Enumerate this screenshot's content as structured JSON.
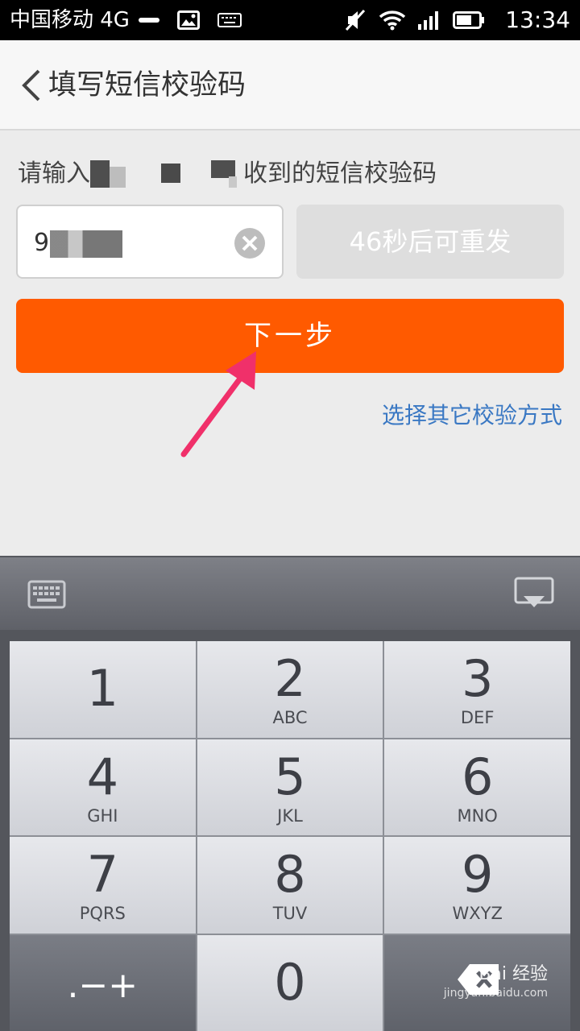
{
  "status_bar": {
    "carrier": "中国移动 4G",
    "time": "13:34"
  },
  "header": {
    "title": "填写短信校验码"
  },
  "content": {
    "prompt_prefix": "请输入",
    "prompt_suffix": "收到的短信校验码",
    "code_value": "9",
    "resend_label": "46秒后可重发",
    "next_label": "下一步",
    "other_method_link": "选择其它校验方式"
  },
  "keypad": {
    "keys": [
      {
        "num": "1",
        "letters": ""
      },
      {
        "num": "2",
        "letters": "ABC"
      },
      {
        "num": "3",
        "letters": "DEF"
      },
      {
        "num": "4",
        "letters": "GHI"
      },
      {
        "num": "5",
        "letters": "JKL"
      },
      {
        "num": "6",
        "letters": "MNO"
      },
      {
        "num": "7",
        "letters": "PQRS"
      },
      {
        "num": "8",
        "letters": "TUV"
      },
      {
        "num": "9",
        "letters": "WXYZ"
      }
    ],
    "symbols_label": ".−+",
    "zero_label": "0"
  },
  "watermark": {
    "brand": "Bai 经验",
    "url": "jingyan.baidu.com"
  },
  "colors": {
    "accent_orange": "#ff5a00",
    "link_blue": "#3a78c3",
    "annotation_arrow": "#f0306a"
  }
}
